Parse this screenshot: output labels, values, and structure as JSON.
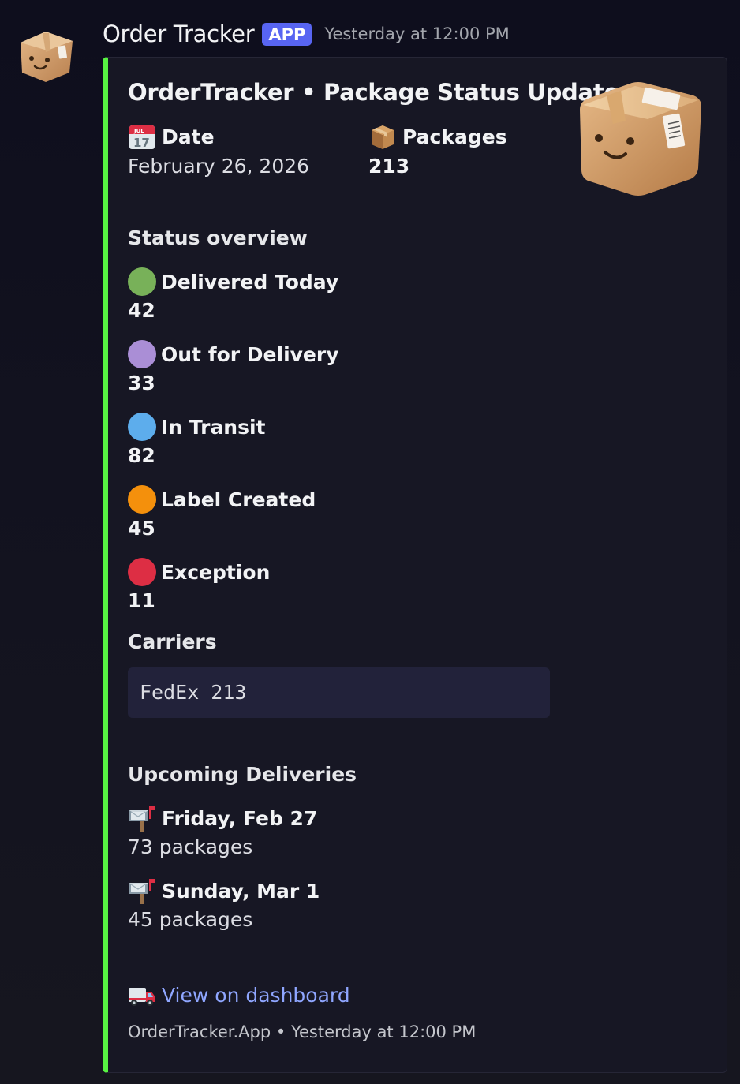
{
  "message": {
    "username": "Order Tracker",
    "badge": "APP",
    "timestamp": "Yesterday at 12:00 PM",
    "avatar_icon": "package-face-icon"
  },
  "embed": {
    "accent_color": "#57f342",
    "title": "OrderTracker • Package Status Update",
    "thumbnail_icon": "package-face-icon",
    "fields": {
      "date": {
        "icon": "calendar-icon",
        "name": "Date",
        "value": "February 26, 2026"
      },
      "packages": {
        "icon": "package-icon",
        "name": "Packages",
        "value": "213"
      }
    },
    "status_overview": {
      "title": "Status overview",
      "items": [
        {
          "name": "Delivered Today",
          "count": "42",
          "color": "#78b159"
        },
        {
          "name": "Out for Delivery",
          "count": "33",
          "color": "#aa8ed6"
        },
        {
          "name": "In Transit",
          "count": "82",
          "color": "#5dadec"
        },
        {
          "name": "Label Created",
          "count": "45",
          "color": "#f4900c"
        },
        {
          "name": "Exception",
          "count": "11",
          "color": "#dd2e44"
        }
      ]
    },
    "carriers": {
      "title": "Carriers",
      "code": "FedEx 213"
    },
    "upcoming": {
      "title": "Upcoming Deliveries",
      "items": [
        {
          "icon": "mailbox-icon",
          "date": "Friday, Feb 27",
          "count": "73 packages"
        },
        {
          "icon": "mailbox-icon",
          "date": "Sunday, Mar 1",
          "count": "45 packages"
        }
      ]
    },
    "link": {
      "icon": "delivery-truck-icon",
      "label": "View on dashboard"
    },
    "footer": "OrderTracker.App • Yesterday at 12:00 PM"
  }
}
